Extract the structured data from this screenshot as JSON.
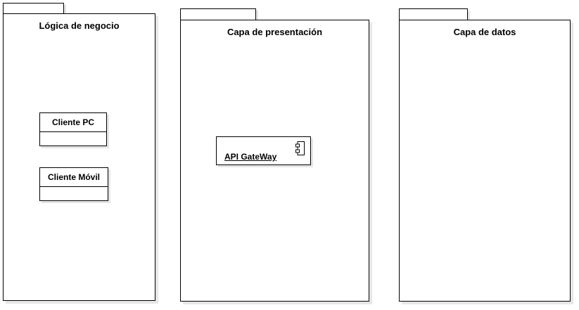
{
  "packages": [
    {
      "title": "Lógica de negocio",
      "classes": [
        {
          "name": "Cliente PC"
        },
        {
          "name": "Cliente Móvil"
        }
      ]
    },
    {
      "title": "Capa de presentación",
      "components": [
        {
          "name": "API GateWay",
          "icon": "component-icon"
        }
      ]
    },
    {
      "title": "Capa de datos"
    }
  ],
  "colors": {
    "stroke": "#000000",
    "fill": "#ffffff",
    "shadow": "#e6e6e6"
  }
}
